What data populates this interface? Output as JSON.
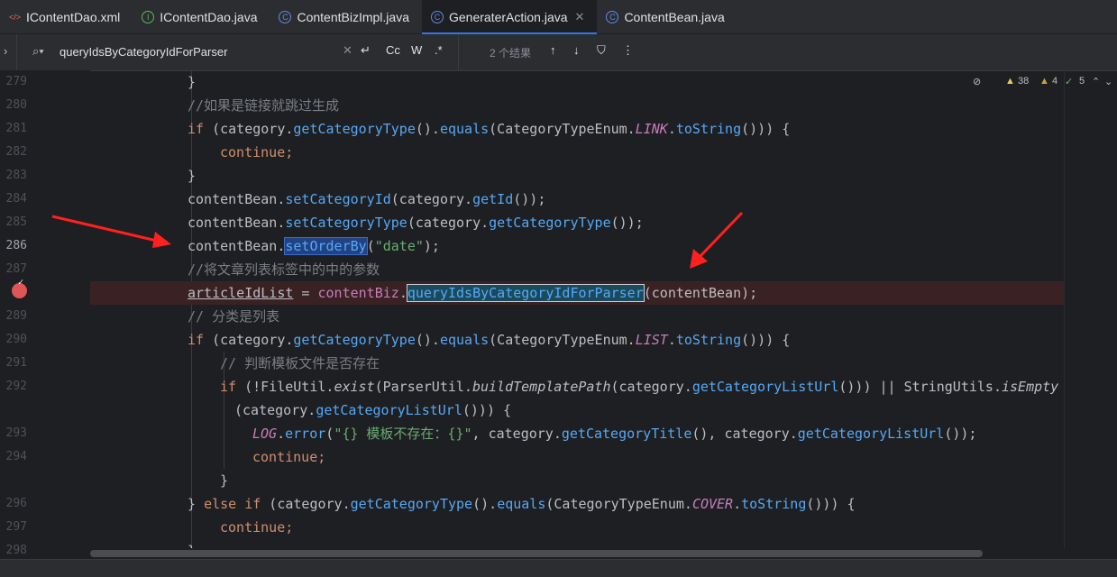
{
  "tabs": [
    {
      "label": "IContentDao.xml",
      "icon": "xml-file-icon",
      "active": false
    },
    {
      "label": "IContentDao.java",
      "icon": "interface-icon",
      "active": false
    },
    {
      "label": "ContentBizImpl.java",
      "icon": "class-icon",
      "active": false
    },
    {
      "label": "GeneraterAction.java",
      "icon": "class-icon",
      "active": true
    },
    {
      "label": "ContentBean.java",
      "icon": "class-icon",
      "active": false
    }
  ],
  "search": {
    "query": "queryIdsByCategoryIdForParser",
    "result_count": "2 个结果",
    "match_case": "Cc",
    "words": "W",
    "regex": ".*"
  },
  "inspections": {
    "warnings": "38",
    "weak_warnings": "4",
    "ok": "5"
  },
  "line_numbers": [
    "279",
    "280",
    "281",
    "282",
    "283",
    "284",
    "285",
    "286",
    "287",
    "",
    "289",
    "290",
    "291",
    "292",
    "",
    "293",
    "294",
    "",
    "296",
    "297",
    "298"
  ],
  "code": {
    "l1": "}",
    "l2": "//如果是链接就跳过生成",
    "l3a": "if",
    "l3b": " (category.",
    "l3c": "getCategoryType",
    "l3d": "().",
    "l3e": "equals",
    "l3f": "(CategoryTypeEnum.",
    "l3g": "LINK",
    "l3h": ".",
    "l3i": "toString",
    "l3j": "())) {",
    "l4": "continue;",
    "l5": "}",
    "l6a": "contentBean.",
    "l6b": "setCategoryId",
    "l6c": "(category.",
    "l6d": "getId",
    "l6e": "());",
    "l7a": "contentBean.",
    "l7b": "setCategoryType",
    "l7c": "(category.",
    "l7d": "getCategoryType",
    "l7e": "());",
    "l8a": "contentBean.",
    "l8b": "setOrderBy",
    "l8c": "(",
    "l8d": "\"date\"",
    "l8e": ");",
    "l9": "//将文章列表标签中的中的参数",
    "l10a": "articleIdList",
    "l10b": " = ",
    "l10c": "contentBiz",
    "l10d": ".",
    "l10e": "queryIdsByCategoryIdForParser",
    "l10f": "(contentBean);",
    "l11": "// 分类是列表",
    "l12a": "if",
    "l12b": " (category.",
    "l12c": "getCategoryType",
    "l12d": "().",
    "l12e": "equals",
    "l12f": "(CategoryTypeEnum.",
    "l12g": "LIST",
    "l12h": ".",
    "l12i": "toString",
    "l12j": "())) {",
    "l13": "// 判断模板文件是否存在",
    "l14a": "if",
    "l14b": " (!FileUtil.",
    "l14c": "exist",
    "l14d": "(ParserUtil.",
    "l14e": "buildTemplatePath",
    "l14f": "(category.",
    "l14g": "getCategoryListUrl",
    "l14h": "())) || StringUtils.",
    "l14i": "isEmpty",
    "l15a": "(category.",
    "l15b": "getCategoryListUrl",
    "l15c": "())) {",
    "l16a": "LOG",
    "l16b": ".",
    "l16c": "error",
    "l16d": "(",
    "l16e": "\"{} 模板不存在：{}\"",
    "l16f": ", category.",
    "l16g": "getCategoryTitle",
    "l16h": "(), category.",
    "l16i": "getCategoryListUrl",
    "l16j": "());",
    "l17": "continue;",
    "l18": "}",
    "l19a": "} ",
    "l19b": "else if",
    "l19c": " (category.",
    "l19d": "getCategoryType",
    "l19e": "().",
    "l19f": "equals",
    "l19g": "(CategoryTypeEnum.",
    "l19h": "COVER",
    "l19i": ".",
    "l19j": "toString",
    "l19k": "())) {",
    "l20": "continue;",
    "l21": "}"
  }
}
